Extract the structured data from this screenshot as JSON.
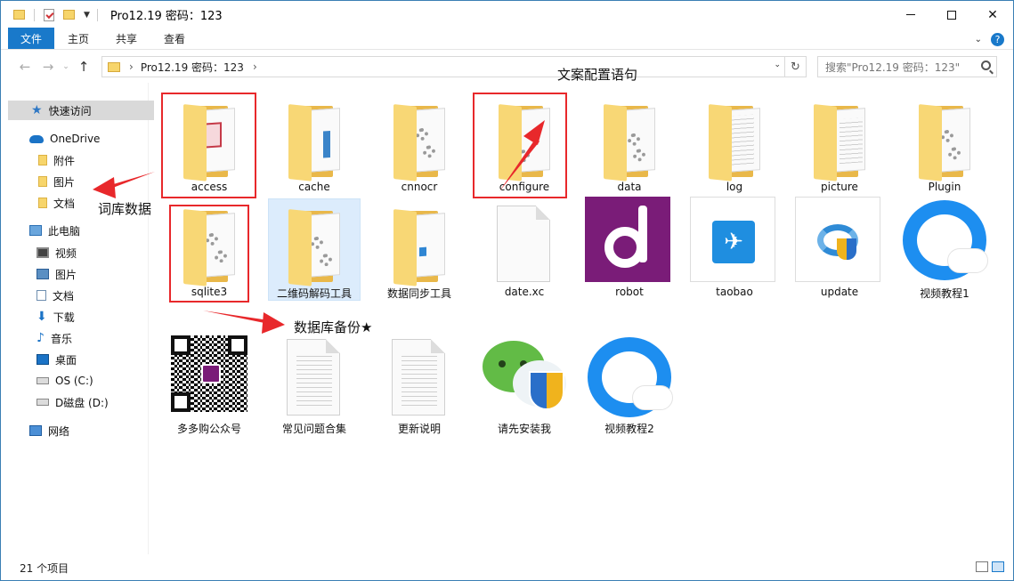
{
  "window": {
    "title": "Pro12.19 密码：123",
    "minimize": "minimize",
    "maximize": "maximize",
    "close": "✕"
  },
  "ribbon": {
    "tabs": [
      "文件",
      "主页",
      "共享",
      "查看"
    ]
  },
  "address": {
    "breadcrumb": "Pro12.19 密码：123",
    "separator": "›",
    "search_placeholder": "搜索\"Pro12.19 密码：123\""
  },
  "sidebar": {
    "items": [
      {
        "label": "快速访问",
        "icon": "star-icon"
      },
      {
        "label": "OneDrive",
        "icon": "cloud-icon"
      },
      {
        "label": "附件",
        "icon": "folder-icon"
      },
      {
        "label": "图片",
        "icon": "folder-icon"
      },
      {
        "label": "文档",
        "icon": "folder-icon"
      },
      {
        "label": "此电脑",
        "icon": "computer-icon"
      },
      {
        "label": "视频",
        "icon": "video-icon"
      },
      {
        "label": "图片",
        "icon": "pictures-icon"
      },
      {
        "label": "文档",
        "icon": "documents-icon"
      },
      {
        "label": "下载",
        "icon": "download-icon"
      },
      {
        "label": "音乐",
        "icon": "music-icon"
      },
      {
        "label": "桌面",
        "icon": "desktop-icon"
      },
      {
        "label": "OS (C:)",
        "icon": "drive-icon"
      },
      {
        "label": "D磁盘 (D:)",
        "icon": "drive-icon"
      },
      {
        "label": "网络",
        "icon": "network-icon"
      }
    ]
  },
  "files": {
    "row1": [
      "access",
      "cache",
      "cnnocr",
      "configure",
      "data",
      "log",
      "picture",
      "Plugin"
    ],
    "row2": [
      "sqlite3",
      "二维码解码工具",
      "数据同步工具",
      "date.xc",
      "robot",
      "taobao",
      "update",
      "视频教程1"
    ],
    "row3": [
      "多多购公众号",
      "常见问题合集",
      "更新说明",
      "请先安装我",
      "视频教程2"
    ]
  },
  "annotations": {
    "config": "文案配置语句",
    "lexicon": "词库数据",
    "backup": "数据库备份★"
  },
  "status": {
    "count": "21 个项目"
  },
  "colors": {
    "accent": "#1979ca",
    "highlight_red": "#e8282b",
    "robot_purple": "#7a1c78"
  }
}
